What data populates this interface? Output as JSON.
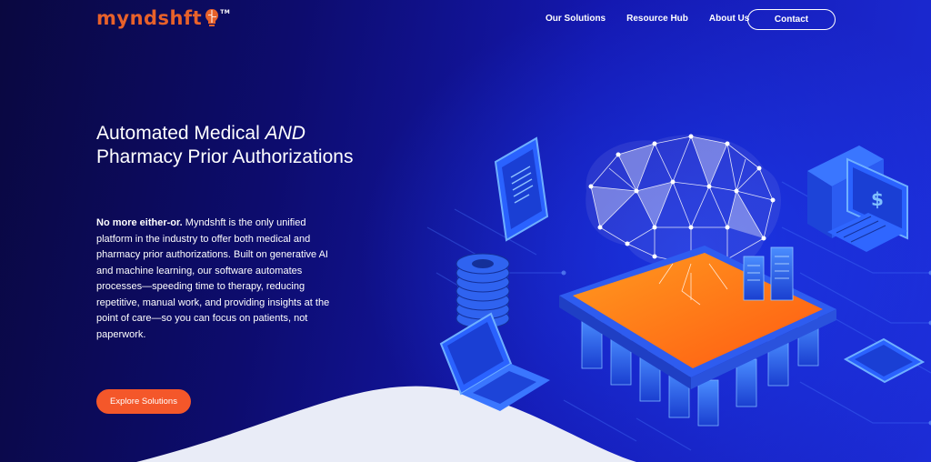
{
  "brand": {
    "logo_text": "myndshft",
    "logo_tm": "TM",
    "accent_color": "#e8612a"
  },
  "nav": {
    "items": [
      "Our Solutions",
      "Resource Hub",
      "About Us"
    ],
    "contact_label": "Contact"
  },
  "hero": {
    "headline_part1": "Automated Medical ",
    "headline_em": "AND",
    "headline_part2": " Pharmacy Prior Authorizations",
    "body_strong": "No more either-or.",
    "body_text": " Myndshft is the only unified platform in the industry to offer both medical and pharmacy prior authorizations. Built on generative AI and machine learning, our software automates processes—speeding time to therapy, reducing repetitive, manual work, and providing insights at the point of care—so you can focus on patients, not paperwork.",
    "cta_label": "Explore Solutions",
    "cta_color": "#f4572a"
  },
  "illustration": {
    "icons": [
      "tablet-icon",
      "brain-network-icon",
      "desktop-dollar-icon",
      "gear-stack-icon",
      "laptop-icon",
      "server-chip-icon",
      "phone-icon"
    ],
    "dollar_symbol": "$"
  }
}
